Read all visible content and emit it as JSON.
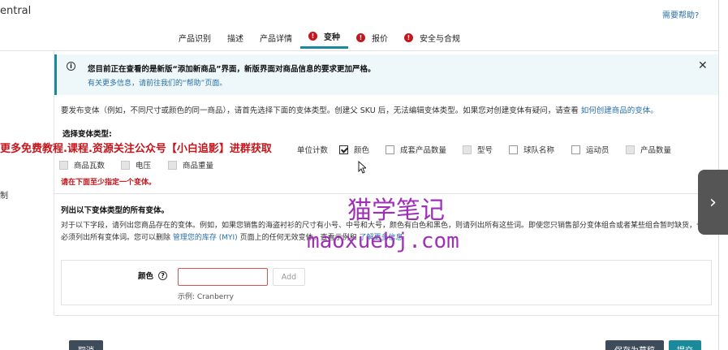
{
  "app": {
    "brand": "entral",
    "help_link": "需要帮助?"
  },
  "tabs": [
    {
      "label": "产品识别",
      "warning": false,
      "active": false
    },
    {
      "label": "描述",
      "warning": false,
      "active": false
    },
    {
      "label": "产品详情",
      "warning": false,
      "active": false
    },
    {
      "label": "变种",
      "warning": true,
      "active": true
    },
    {
      "label": "报价",
      "warning": true,
      "active": false
    },
    {
      "label": "安全与合规",
      "warning": true,
      "active": false
    }
  ],
  "warning_glyph": "!",
  "left_stub": "制",
  "banner": {
    "icon": "info-icon",
    "title": "您目前正在查看的是新版“添加新商品”界面，新版界面对商品信息的要求更加严格。",
    "link": "有关更多信息，请前往我们的“帮助”页面。",
    "close": "✕"
  },
  "intro": {
    "text": "要发布变体（例如，不同尺寸或颜色的同一商品），请首先选择下面的变体类型。创建父 SKU 后，无法编辑变体类型。如果您对创建变体有疑问，请查看",
    "link": "如何创建商品的变体。"
  },
  "variation": {
    "label": "选择变体类型:",
    "partial_option": "单位计数",
    "options_row1": [
      {
        "label": "颜色",
        "checked": true,
        "disabled": false
      },
      {
        "label": "成套产品数量",
        "checked": false,
        "disabled": false
      },
      {
        "label": "型号",
        "checked": false,
        "disabled": true
      },
      {
        "label": "球队名称",
        "checked": false,
        "disabled": false
      },
      {
        "label": "运动员",
        "checked": false,
        "disabled": false
      },
      {
        "label": "产品数量",
        "checked": false,
        "disabled": true
      }
    ],
    "options_row2": [
      {
        "label": "商品瓦数",
        "checked": false,
        "disabled": true
      },
      {
        "label": "电压",
        "checked": false,
        "disabled": true
      },
      {
        "label": "商品重量",
        "checked": false,
        "disabled": true
      }
    ],
    "error": "请在下面至少指定一个变体。"
  },
  "list_section": {
    "title": "列出以下变体类型的所有变体。",
    "desc_line1": "对于以下字段，请列出您商品存在的变体。例如，如果您销售的海盗衬衫的尺寸有小号、中号和大号，颜色有白色和黑色，则请列出所有这些词。即使您只销售部分变体组合或者某些组合暂时缺货，也",
    "desc_line2_a": "必须列出所有变体词。您可以删除",
    "desc_line2_link1": "管理您的库存 (MYI)",
    "desc_line2_b": "页面上的任何无效变体。查看示例和",
    "desc_line2_link2": "了解更多信息"
  },
  "field": {
    "label": "颜色",
    "help_icon": "?",
    "value": "",
    "add_label": "Add",
    "example": "示例:   Cranberry"
  },
  "footer": {
    "cancel": "取消",
    "save_draft": "保存为草稿",
    "submit": "提交"
  },
  "watermarks": {
    "red": "更多免费教程.课程.资源关注公众号【小白追影】进群获取",
    "purple_cn": "猫学笔记",
    "purple_url": "maoxuebj.com"
  },
  "next_arrow": "›"
}
